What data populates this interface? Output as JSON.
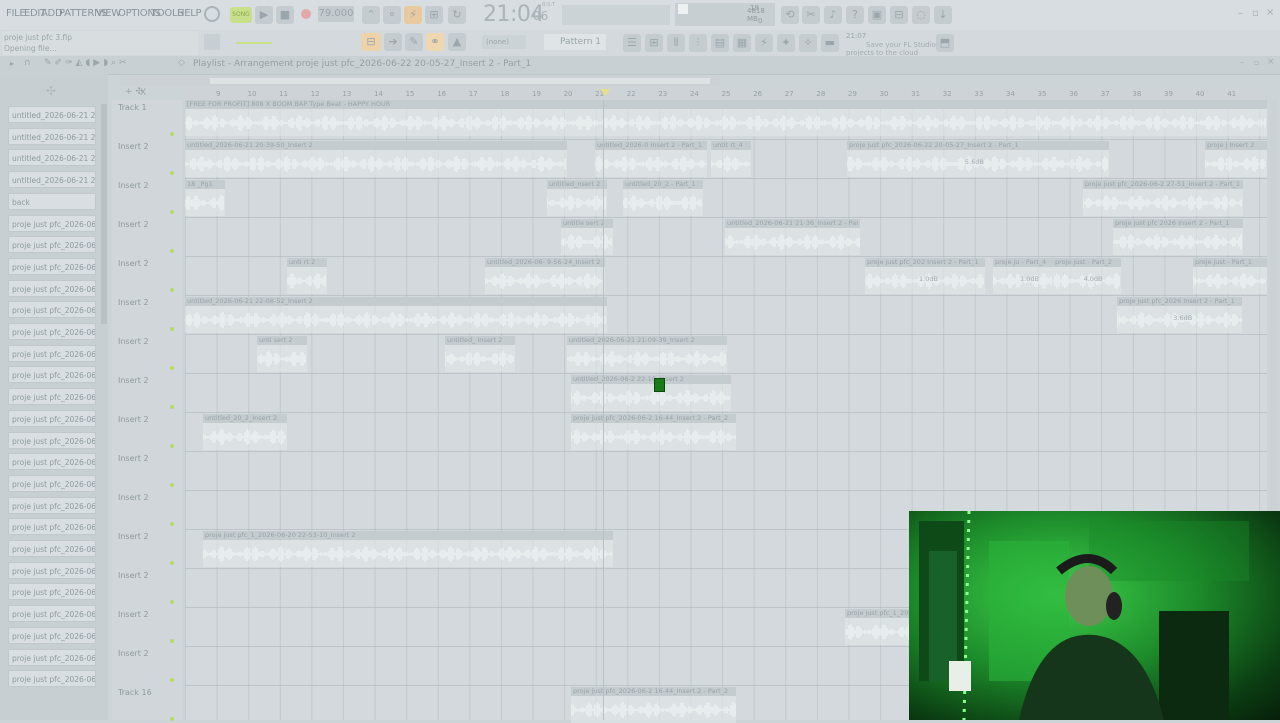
{
  "menu": [
    "FILE",
    "EDIT",
    "ADD",
    "PATTERNS",
    "VIEW",
    "OPTIONS",
    "TOOLS",
    "HELP"
  ],
  "transport": {
    "mode": "SONG",
    "tempo": "79.000",
    "time_main": "21:04",
    "time_sub": "06",
    "time_label": "B:S:T",
    "memory": "4818 MB",
    "cpu_voices": "19",
    "cpu_zero": "0"
  },
  "status": {
    "file": "proje just pfc 3.flp",
    "action": "Opening file..."
  },
  "second_bar": {
    "none_select": "(none)",
    "pattern": "Pattern 1",
    "hint_time": "21:07",
    "hint_text": "Save your FL Studio projects to the cloud"
  },
  "playlist_bar": {
    "title": "Playlist - Arrangement",
    "arrangement": "proje just pfc_2026-06-22 20-05-27_Insert 2 - Part_1"
  },
  "ruler": [
    "9",
    "10",
    "11",
    "12",
    "13",
    "14",
    "15",
    "16",
    "17",
    "18",
    "19",
    "20",
    "21",
    "22",
    "23",
    "24",
    "25",
    "26",
    "27",
    "28",
    "29",
    "30",
    "31",
    "32",
    "33",
    "34",
    "35",
    "36",
    "37",
    "38",
    "39",
    "40",
    "41"
  ],
  "browser": [
    "untitled_2026-06-21 21-",
    "untitled_2026-06-21 21-",
    "untitled_2026-06-21 21-",
    "untitled_2026-06-21 21-",
    "back",
    "proje just pfc_2026-06-2",
    "proje just pfc_2026-06-2",
    "proje just pfc_2026-06-2",
    "proje just pfc_2026-06-2",
    "proje just pfc_2026-06-2",
    "proje just pfc_2026-06-2",
    "proje just pfc_2026-06-2",
    "proje just pfc_2026-06-2",
    "proje just pfc_2026-06-2",
    "proje just pfc_2026-06-2",
    "proje just pfc_2026-06-2",
    "proje just pfc_2026-06-2",
    "proje just pfc_2026-06-2",
    "proje just pfc_2026-06-2",
    "proje just pfc_2026-06-2",
    "proje just pfc_2026-06-2",
    "proje just pfc_2026-06-2",
    "proje just pfc_2026-06-2",
    "proje just pfc_2026-06-2",
    "proje just pfc_2026-06-2",
    "proje just pfc_2026-06-2",
    "proje just pfc_2026-06-2"
  ],
  "tracks": [
    "Track 1",
    "Insert 2",
    "Insert 2",
    "Insert 2",
    "Insert 2",
    "Insert 2",
    "Insert 2",
    "Insert 2",
    "Insert 2",
    "Insert 2",
    "Insert 2",
    "Insert 2",
    "Insert 2",
    "Insert 2",
    "Insert 2",
    "Track 16"
  ],
  "clips": [
    {
      "title": "[FREE FOR PROFIT] 808 X BOOM BAP Type Beat - HAPPY HOUR"
    },
    {
      "title": "untitled_2026-06-21 20-39-50_Insert 2"
    },
    {
      "title": "untitled_2026-0 Insert 2 - Part_1"
    },
    {
      "title": "untit rt_4"
    },
    {
      "title": "proje just pfc_2026-06-22 20-05-27_Insert 2 - Part_1",
      "label": "5.6dB"
    },
    {
      "title": "proje j Insert 2"
    },
    {
      "title": "18 _Pg1"
    },
    {
      "title": "untitled_nsert 2"
    },
    {
      "title": "untitled_20_2 - Part_1"
    },
    {
      "title": "proje just pfc_2026-06-2 27-51_Insert 2 - Part_1"
    },
    {
      "title": "untitle sert 2"
    },
    {
      "title": "untitled_2026-06-21 21-36_Insert 2 - Part_1"
    },
    {
      "title": "proje just pfc 2026 Insert 2 - Part_1"
    },
    {
      "title": "unti rt 2"
    },
    {
      "title": "untitled_2026-06- 9-56-24_Insert 2"
    },
    {
      "title": "proje just pfc_202 Insert 2 - Part_1",
      "label": "1.0dB"
    },
    {
      "title": "proje ju - Part_4",
      "label": "1.0dB"
    },
    {
      "title": "proje just - Part_2",
      "label": "4.0dB"
    },
    {
      "title": "proje just - Part_1"
    },
    {
      "title": "untitled_2026-06-21 22-08-52_Insert 2"
    },
    {
      "title": "proje just pfc_2026 Insert 2 - Part_1",
      "label": "3.6dB"
    },
    {
      "title": "unti sert 2"
    },
    {
      "title": "untitled_ Insert 2"
    },
    {
      "title": "untitled_2026-06-21 21-09-39_Insert 2"
    },
    {
      "title": "untitled_2026-06-2 22-10_Insert 2"
    },
    {
      "title": "untitled_20_2_Insert 2"
    },
    {
      "title": "proje just pfc_2026-06-2 16-44_Insert 2 - Part_2"
    },
    {
      "title": "proje just pfc_1_2026-06-20 22-53-10_Insert 2"
    },
    {
      "title": "proje just pfc_1_2026-06"
    },
    {
      "title": "proje just pfc_2026-06-2 16-44_Insert 2 - Part_2"
    }
  ]
}
